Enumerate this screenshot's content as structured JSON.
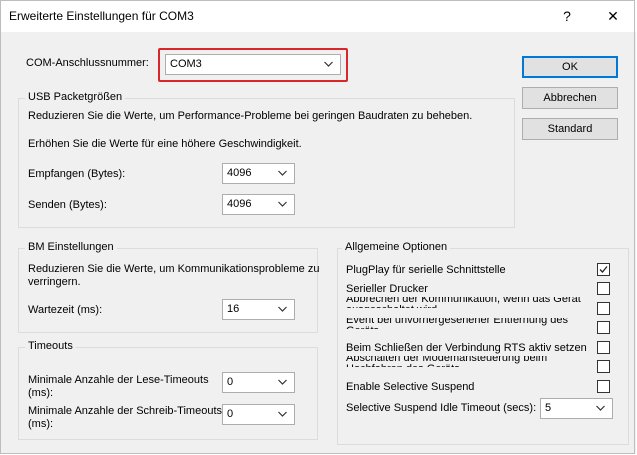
{
  "window": {
    "title": "Erweiterte Einstellungen für COM3",
    "help_glyph": "?",
    "close_glyph": "✕"
  },
  "com_port": {
    "label": "COM-Anschlussnummer:",
    "value": "COM3"
  },
  "buttons": {
    "ok": "OK",
    "cancel": "Abbrechen",
    "standard": "Standard"
  },
  "usb": {
    "group_label": "USB Packetgrößen",
    "info1": "Reduzieren Sie die Werte, um Performance-Probleme bei geringen Baudraten zu beheben.",
    "info2": "Erhöhen Sie die Werte für eine höhere Geschwindigkeit.",
    "receive_label": "Empfangen (Bytes):",
    "receive_value": "4096",
    "send_label": "Senden (Bytes):",
    "send_value": "4096"
  },
  "bm": {
    "group_label": "BM Einstellungen",
    "info_line1": "Reduzieren Sie die Werte, um Kommunikationsprobleme zu",
    "info_line2": "verringern.",
    "latency_label": "Wartezeit (ms):",
    "latency_value": "16"
  },
  "timeouts": {
    "group_label": "Timeouts",
    "read_line1": "Minimale Anzahle der Lese-Timeouts",
    "read_line2": "(ms):",
    "read_value": "0",
    "write_line1": "Minimale Anzahle der Schreib-Timeouts",
    "write_line2": "(ms):",
    "write_value": "0"
  },
  "general": {
    "group_label": "Allgemeine Optionen",
    "options": [
      {
        "label": "PlugPlay für serielle Schnittstelle",
        "checked": true
      },
      {
        "label": "Serieller Drucker",
        "checked": false
      },
      {
        "label": "Abbrechen der Kommunikation, wenn das Gerät ausgeschaltet wird",
        "checked": false
      },
      {
        "label": "Event bei unvorhergesehener Entfernung des Geräts",
        "checked": false
      },
      {
        "label": "Beim Schließen der Verbindung RTS aktiv setzen",
        "checked": false
      },
      {
        "label": "Abschalten der Modemansteuerung beim Hochfahren des Geräts",
        "checked": false
      },
      {
        "label": "Enable Selective Suspend",
        "checked": false
      }
    ],
    "idle_label": "Selective Suspend Idle Timeout (secs):",
    "idle_value": "5"
  },
  "colors": {
    "highlight_border": "#d9262b",
    "default_button_border": "#0078d7",
    "dialog_background": "#f0f0f0"
  }
}
